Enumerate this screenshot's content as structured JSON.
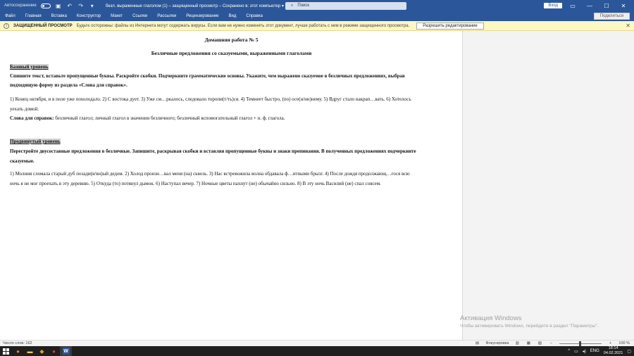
{
  "titlebar": {
    "autosave_label": "Автосохранение",
    "doc_title": "безл. выраженные глаголом (1) – защищенный просмотр – Сохранено в: этот компьютер ▾",
    "search_placeholder": "Поиск",
    "signin_label": "Вход",
    "minimize": "—",
    "maximize": "☐",
    "close": "✕"
  },
  "ribbon": {
    "tabs": [
      "Файл",
      "Главная",
      "Вставка",
      "Конструктор",
      "Макет",
      "Ссылки",
      "Рассылки",
      "Рецензирование",
      "Вид",
      "Справка"
    ],
    "share_label": "Поделиться"
  },
  "protected_bar": {
    "label": "ЗАЩИЩЕННЫЙ ПРОСМОТР",
    "message": "Будьте осторожны: файлы из Интернета могут содержать вирусы. Если вам не нужно изменять этот документ, лучше работать с ним в режиме защищенного просмотра.",
    "enable_button": "Разрешить редактирование"
  },
  "document": {
    "title": "Домашняя работа № 5",
    "subtitle": "Безличные предложения со сказуемыми, выраженными глаголами",
    "basic_heading": "Базовый уровень",
    "basic_task_1": "Спишите текст, вставьте пропущенные буквы. Раскройте скобки. Подчеркните грамматические основы. Укажите, чем выражено сказуемое в безличных предложениях, выбрав",
    "basic_task_2": "подходящую форму из раздела «Слова для справок».",
    "basic_text_1": "1) Конец октября, и в поле уже похолодало. 2) С востока дует. 3) Уже см…ркалось, следовало торопи(т/ть)ся. 4) Темнеет быстро, (по) осе(н/нн)нему. 5) Вдруг стало накрап…вать. 6) Хотелось",
    "basic_text_2": "уехать домой.",
    "ref_label": "Слова для справок:",
    "ref_text": " безличный глагол; личный глагол в значении безличного; безличный вспомогательный глагол + н. ф. глагола.",
    "adv_heading": "Продвинутый уровень",
    "adv_task_1": "Перестройте двусоставные предложения в безличные. Запишите, раскрывая скобки и вставляя пропущенные буквы и знаки препинания. В полученных предложениях подчеркните",
    "adv_task_2": "сказуемые.",
    "adv_text_1": "1) Молния сломала старый дуб позади(в/вн)ый дедом. 2) Холод пронзи…вал меня (на) сквозь. 3) Нас встревожила волна обдавала ф…итными брызг. 4) После дождя продолжающ…гося всю",
    "adv_text_2": "ночь я не мог проехать в эту деревню. 5) Откуда (то) потянул дымок. 6) Наступал вечер. 7) Ночные цветы пахнут (не) обычайно сильно. 8) В эту ночь Василий (не) спал совсем."
  },
  "activation": {
    "title": "Активация Windows",
    "subtitle": "Чтобы активировать Windows, перейдите в раздел \"Параметры\"."
  },
  "statusbar": {
    "word_count": "Число слов: 162",
    "focus_label": "Фокусировка",
    "zoom": "100 %"
  },
  "taskbar": {
    "language": "ENG",
    "time": "18:14",
    "date": "04.02.2021"
  }
}
